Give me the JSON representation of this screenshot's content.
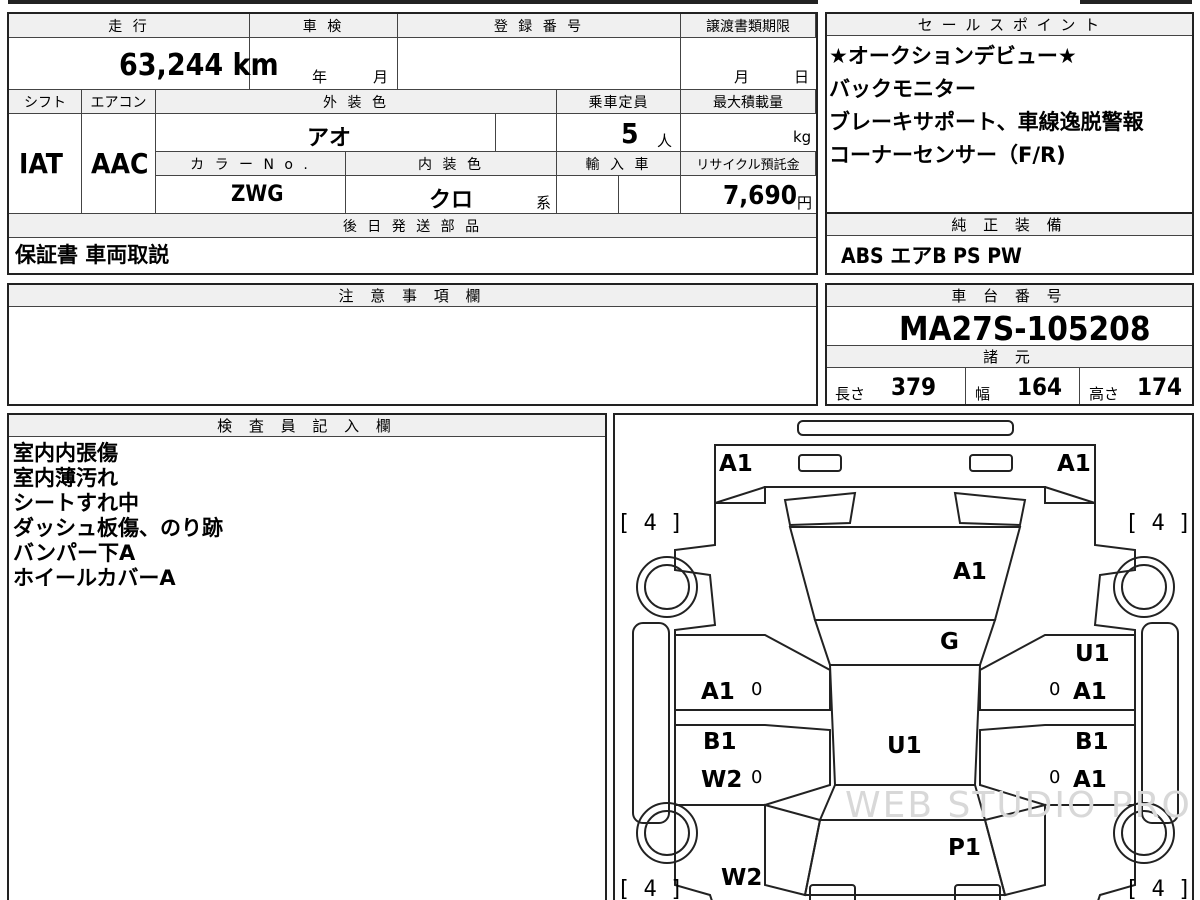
{
  "labels": {
    "mileage": "走 行",
    "shaken": "車 検",
    "reg_no": "登 録 番 号",
    "transfer_deadline": "譲渡書類期限",
    "sales_points": "セ ー ル ス ポ イ ン ト",
    "shift": "シフト",
    "aircon": "エアコン",
    "ext_color": "外 装 色",
    "capacity": "乗車定員",
    "max_load": "最大積載量",
    "color_no": "カ ラ ー N o .",
    "int_color": "内 装 色",
    "import": "輸 入 車",
    "recycle": "リサイクル預託金",
    "later_parts": "後 日 発 送 部 品",
    "oem_equipment": "純 正 装 備",
    "notes": "注 意 事 項 欄",
    "chassis_no": "車 台 番 号",
    "specs": "諸 元",
    "inspector": "検 査 員 記 入 欄"
  },
  "values": {
    "mileage": "63,244 km",
    "shaken_year": "年",
    "shaken_month": "月",
    "deadline_month": "月",
    "deadline_day": "日",
    "shift": "IAT",
    "aircon": "AAC",
    "ext_color": "アオ",
    "capacity": "5",
    "capacity_unit": "人",
    "max_load_unit": "kg",
    "color_no": "ZWG",
    "int_color": "クロ",
    "int_color_suffix": "系",
    "recycle": "7,690",
    "recycle_unit": "円",
    "later_parts": "保証書 車両取説",
    "oem_equipment": "ABS エアB PS PW",
    "chassis_no": "MA27S-105208",
    "length_label": "長さ",
    "length": "379",
    "width_label": "幅",
    "width": "164",
    "height_label": "高さ",
    "height": "174"
  },
  "sales_points": [
    "★オークションデビュー★",
    "バックモニター",
    "ブレーキサポート、車線逸脱警報",
    "コーナーセンサー（F/R)"
  ],
  "inspector_notes": [
    "室内内張傷",
    "室内薄汚れ",
    "シートすれ中",
    "ダッシュ板傷、のり跡",
    "バンパー下A",
    "ホイールカバーA"
  ],
  "diagram_marks": {
    "a1_left_top": "A1",
    "a1_right_top": "A1",
    "tire_fl": "[ 4 ]",
    "tire_fr": "[ 4 ]",
    "tire_rl": "[ 4 ]",
    "tire_rr": "[ 4 ]",
    "hood": "A1",
    "windshield": "G",
    "roof": "U1",
    "trunk": "P1",
    "front_left_door": "A1",
    "rear_left_door_1": "B1",
    "rear_left_door_2": "W2",
    "front_right_door_1": "U1",
    "front_right_door_2": "A1",
    "rear_right_door_1": "B1",
    "rear_right_door_2": "A1",
    "rear_left_quarter": "W2",
    "zero_1": "0",
    "zero_2": "0",
    "zero_3": "0",
    "zero_4": "0"
  },
  "watermark": "WEB STUDIO PRO"
}
